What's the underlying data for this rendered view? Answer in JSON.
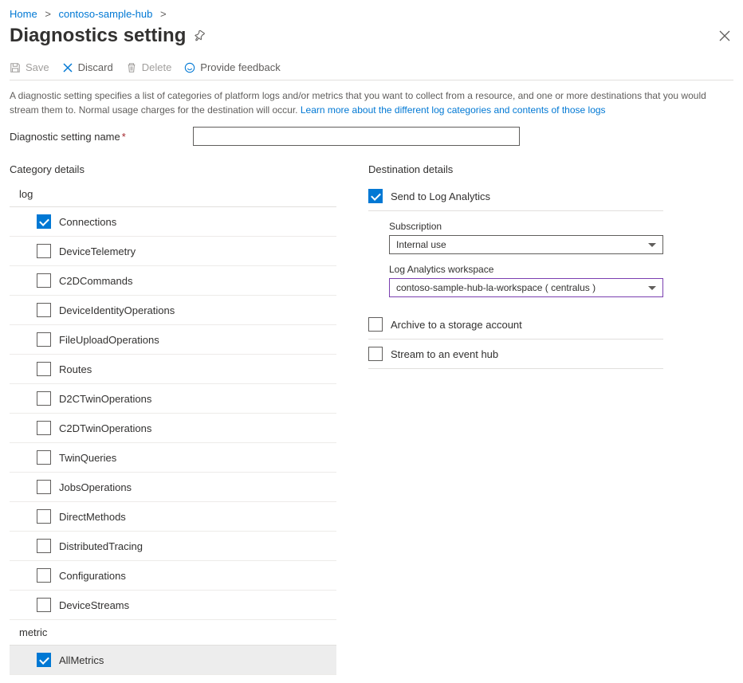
{
  "breadcrumb": {
    "home": "Home",
    "hub": "contoso-sample-hub"
  },
  "page_title": "Diagnostics setting",
  "toolbar": {
    "save": "Save",
    "discard": "Discard",
    "delete": "Delete",
    "feedback": "Provide feedback"
  },
  "description": {
    "text": "A diagnostic setting specifies a list of categories of platform logs and/or metrics that you want to collect from a resource, and one or more destinations that you would stream them to. Normal usage charges for the destination will occur. ",
    "link": "Learn more about the different log categories and contents of those logs"
  },
  "name_field": {
    "label": "Diagnostic setting name",
    "value": ""
  },
  "category": {
    "title": "Category details",
    "log_header": "log",
    "logs": [
      {
        "label": "Connections",
        "checked": true
      },
      {
        "label": "DeviceTelemetry",
        "checked": false
      },
      {
        "label": "C2DCommands",
        "checked": false
      },
      {
        "label": "DeviceIdentityOperations",
        "checked": false
      },
      {
        "label": "FileUploadOperations",
        "checked": false
      },
      {
        "label": "Routes",
        "checked": false
      },
      {
        "label": "D2CTwinOperations",
        "checked": false
      },
      {
        "label": "C2DTwinOperations",
        "checked": false
      },
      {
        "label": "TwinQueries",
        "checked": false
      },
      {
        "label": "JobsOperations",
        "checked": false
      },
      {
        "label": "DirectMethods",
        "checked": false
      },
      {
        "label": "DistributedTracing",
        "checked": false
      },
      {
        "label": "Configurations",
        "checked": false
      },
      {
        "label": "DeviceStreams",
        "checked": false
      }
    ],
    "metric_header": "metric",
    "metrics": [
      {
        "label": "AllMetrics",
        "checked": true
      }
    ]
  },
  "destination": {
    "title": "Destination details",
    "log_analytics": {
      "label": "Send to Log Analytics",
      "checked": true,
      "subscription_label": "Subscription",
      "subscription_value": "Internal use",
      "workspace_label": "Log Analytics workspace",
      "workspace_value": "contoso-sample-hub-la-workspace ( centralus )"
    },
    "storage": {
      "label": "Archive to a storage account",
      "checked": false
    },
    "eventhub": {
      "label": "Stream to an event hub",
      "checked": false
    }
  }
}
